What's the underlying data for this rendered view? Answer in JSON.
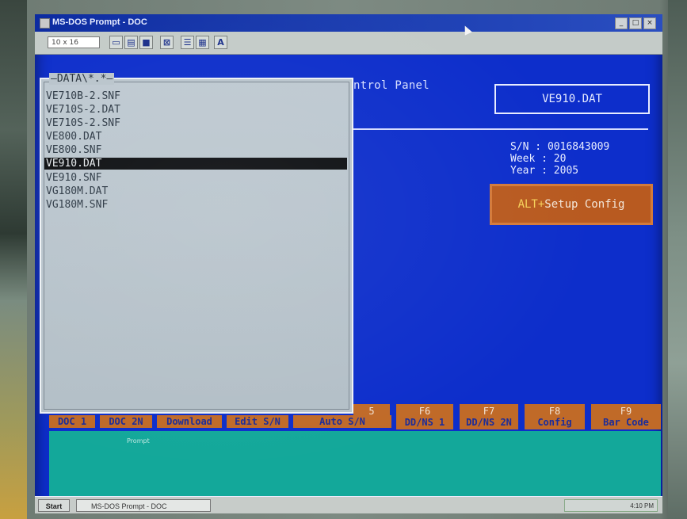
{
  "window": {
    "title": "MS-DOS Prompt - DOC",
    "font_size_value": "10 x 16"
  },
  "toolbar_icons": [
    "mark-icon",
    "copy-icon",
    "paste-icon",
    "fullscreen-icon",
    "properties-icon",
    "background-icon",
    "font-icon"
  ],
  "panel": {
    "title_fragment": "ntrol Panel",
    "selected_file_box": "VE910.DAT",
    "serial_label": "S/N : 0016843009",
    "week_label": "Week : 20",
    "year_label": "Year : 2005",
    "alt_key": "ALT+",
    "alt_action": "Setup Config"
  },
  "file_list": {
    "title": "DATA\\*.*",
    "items": [
      "VE710B-2.SNF",
      "VE710S-2.DAT",
      "VE710S-2.SNF",
      "VE800.DAT",
      "VE800.SNF",
      "VE910.DAT",
      "VE910.SNF",
      "VG180M.DAT",
      "VG180M.SNF"
    ],
    "selected_index": 5
  },
  "function_keys": {
    "f5": "5",
    "f6": {
      "key": "F6",
      "label": "DD/NS 1"
    },
    "f7": {
      "key": "F7",
      "label": "DD/NS 2N"
    },
    "f8": {
      "key": "F8",
      "label": "Config"
    },
    "f9": {
      "key": "F9",
      "label": "Bar Code"
    },
    "bottom_labels": [
      "DOC 1",
      "DOC 2N",
      "Download",
      "Edit S/N",
      "Auto S/N"
    ]
  },
  "teal_label": "Prompt",
  "taskbar": {
    "start": "Start",
    "task": "MS-DOS Prompt - DOC",
    "clock": "4:10 PM"
  },
  "colors": {
    "dos_blue": "#0d2ecb",
    "fkey_orange": "#c06a28",
    "teal": "#13a89a",
    "panel_grey": "#b9c4cc"
  }
}
